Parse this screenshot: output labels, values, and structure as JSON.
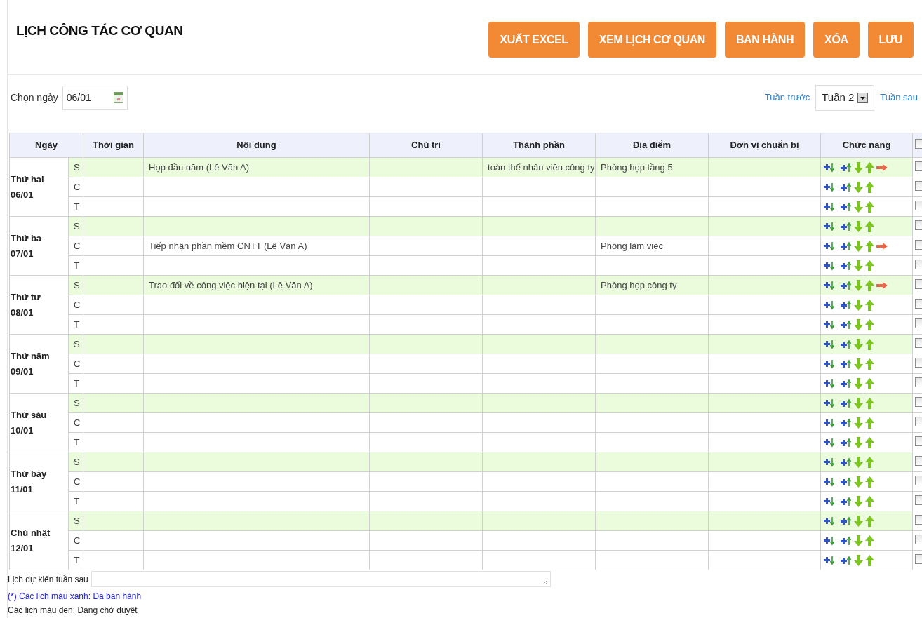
{
  "title": "LỊCH CÔNG TÁC CƠ QUAN",
  "buttons": [
    "XUẤT EXCEL",
    "XEM LỊCH CƠ QUAN",
    "BAN HÀNH",
    "XÓA",
    "LƯU"
  ],
  "date_picker": {
    "label": "Chọn ngày",
    "value": "06/01"
  },
  "week_nav": {
    "prev": "Tuần trước",
    "week": "Tuần 2",
    "next": "Tuần sau"
  },
  "table": {
    "columns": [
      "Ngày",
      "Thời gian",
      "Nội dung",
      "Chủ trì",
      "Thành phần",
      "Địa điểm",
      "Đơn vị chuẩn bị",
      "Chức năng"
    ],
    "header_checked": false,
    "days": [
      {
        "day": "Thứ hai",
        "date": "06/01",
        "slots": [
          {
            "slot": "S",
            "shaded": true,
            "content": "Họp đầu năm (Lê Văn A)",
            "participants": "toàn thể nhân viên công ty",
            "location": "Phòng họp tầng 5",
            "forward": true,
            "checked": false
          },
          {
            "slot": "C",
            "shaded": false,
            "forward": false,
            "checked": false
          },
          {
            "slot": "T",
            "shaded": false,
            "forward": false,
            "checked": false
          }
        ]
      },
      {
        "day": "Thứ ba",
        "date": "07/01",
        "slots": [
          {
            "slot": "S",
            "shaded": true,
            "forward": false,
            "checked": false
          },
          {
            "slot": "C",
            "shaded": false,
            "content": "Tiếp nhận phần mềm CNTT (Lê Văn A)",
            "location": "Phòng làm việc",
            "forward": true,
            "checked": false
          },
          {
            "slot": "T",
            "shaded": false,
            "forward": false,
            "checked": false
          }
        ]
      },
      {
        "day": "Thứ tư",
        "date": "08/01",
        "slots": [
          {
            "slot": "S",
            "shaded": true,
            "content": "Trao đổi về công việc hiện tại (Lê Văn A)",
            "location": "Phòng họp công ty",
            "forward": true,
            "checked": false
          },
          {
            "slot": "C",
            "shaded": false,
            "forward": false,
            "checked": false
          },
          {
            "slot": "T",
            "shaded": false,
            "forward": false,
            "checked": false
          }
        ]
      },
      {
        "day": "Thứ năm",
        "date": "09/01",
        "slots": [
          {
            "slot": "S",
            "shaded": true,
            "forward": false,
            "checked": false
          },
          {
            "slot": "C",
            "shaded": false,
            "forward": false,
            "checked": false
          },
          {
            "slot": "T",
            "shaded": false,
            "forward": false,
            "checked": false
          }
        ]
      },
      {
        "day": "Thứ sáu",
        "date": "10/01",
        "slots": [
          {
            "slot": "S",
            "shaded": true,
            "forward": false,
            "checked": false
          },
          {
            "slot": "C",
            "shaded": false,
            "forward": false,
            "checked": false
          },
          {
            "slot": "T",
            "shaded": false,
            "forward": false,
            "checked": false
          }
        ]
      },
      {
        "day": "Thứ bảy",
        "date": "11/01",
        "slots": [
          {
            "slot": "S",
            "shaded": true,
            "forward": false,
            "checked": false
          },
          {
            "slot": "C",
            "shaded": false,
            "forward": false,
            "checked": false
          },
          {
            "slot": "T",
            "shaded": false,
            "forward": false,
            "checked": false
          }
        ]
      },
      {
        "day": "Chủ nhật",
        "date": "12/01",
        "slots": [
          {
            "slot": "S",
            "shaded": true,
            "forward": false,
            "checked": false
          },
          {
            "slot": "C",
            "shaded": false,
            "forward": false,
            "checked": false
          },
          {
            "slot": "T",
            "shaded": false,
            "forward": false,
            "checked": false
          }
        ]
      }
    ]
  },
  "next_week_field": {
    "label": "Lịch dự kiến tuần sau"
  },
  "legend": [
    "(*) Các lịch màu xanh: Đã ban hành",
    "Các lịch màu đen: Đang chờ duyệt"
  ]
}
